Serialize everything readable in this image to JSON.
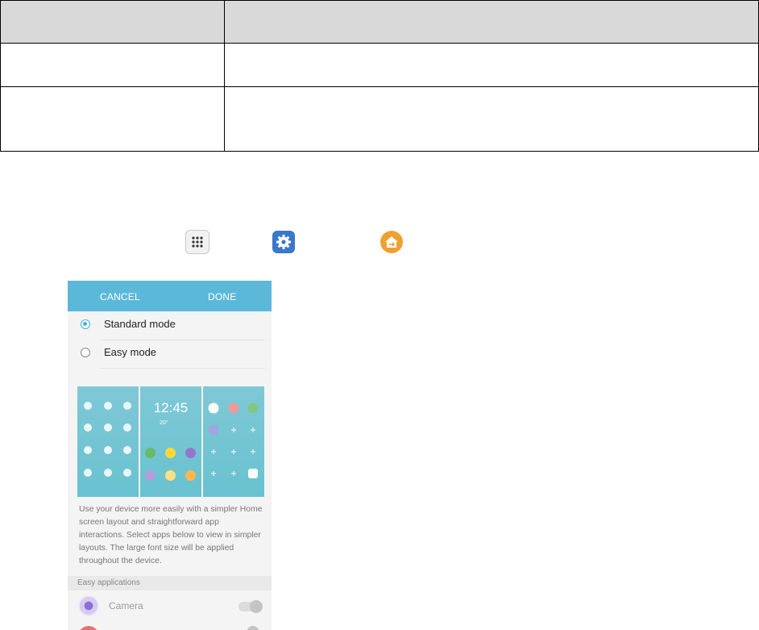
{
  "phone": {
    "header": {
      "cancel": "CANCEL",
      "done": "DONE"
    },
    "modes": [
      {
        "label": "Standard mode",
        "selected": true
      },
      {
        "label": "Easy mode",
        "selected": false
      }
    ],
    "lock_preview": {
      "time": "12:45",
      "weather": "20°"
    },
    "description": "Use your device more easily with a simpler Home screen layout and straightforward app interactions. Select apps below to view in simpler layouts. The large font size will be applied throughout the device.",
    "section_title": "Easy applications",
    "apps": [
      {
        "label": "Camera",
        "toggle_state": "off"
      }
    ]
  },
  "icons": {
    "apps": "apps-grid-icon",
    "settings": "gear-icon",
    "home": "easy-mode-icon"
  },
  "colors": {
    "header_blue": "#5cb8d9",
    "radio_accent": "#41b3d6",
    "settings_blue": "#3a78c9",
    "easy_mode_orange": "#f0a030",
    "table_header_gray": "#d9d9d9"
  }
}
